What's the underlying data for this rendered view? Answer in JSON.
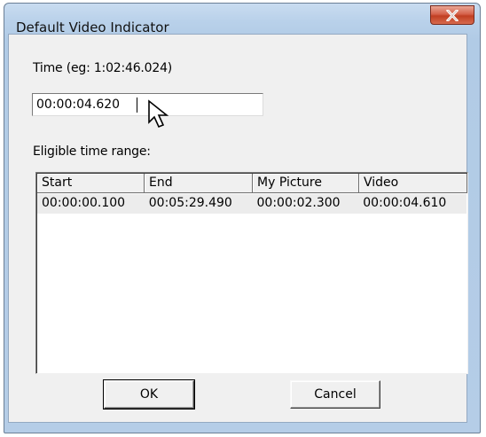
{
  "window": {
    "title": "Default Video Indicator",
    "close_label": "X"
  },
  "form": {
    "time_label": "Time (eg: 1:02:46.024)",
    "time_value": "00:00:04.620",
    "range_label": "Eligible time range:"
  },
  "table": {
    "columns": [
      "Start",
      "End",
      "My Picture",
      "Video"
    ],
    "rows": [
      [
        "00:00:00.100",
        "00:05:29.490",
        "00:00:02.300",
        "00:00:04.610"
      ]
    ]
  },
  "buttons": {
    "ok": "OK",
    "cancel": "Cancel"
  },
  "icons": {
    "close": "close-icon",
    "pointer": "mouse-pointer-icon"
  },
  "colors": {
    "title_gradient": "#b9d1ea",
    "close_button": "#c13f22",
    "dialog_background": "#f0f0f0"
  }
}
